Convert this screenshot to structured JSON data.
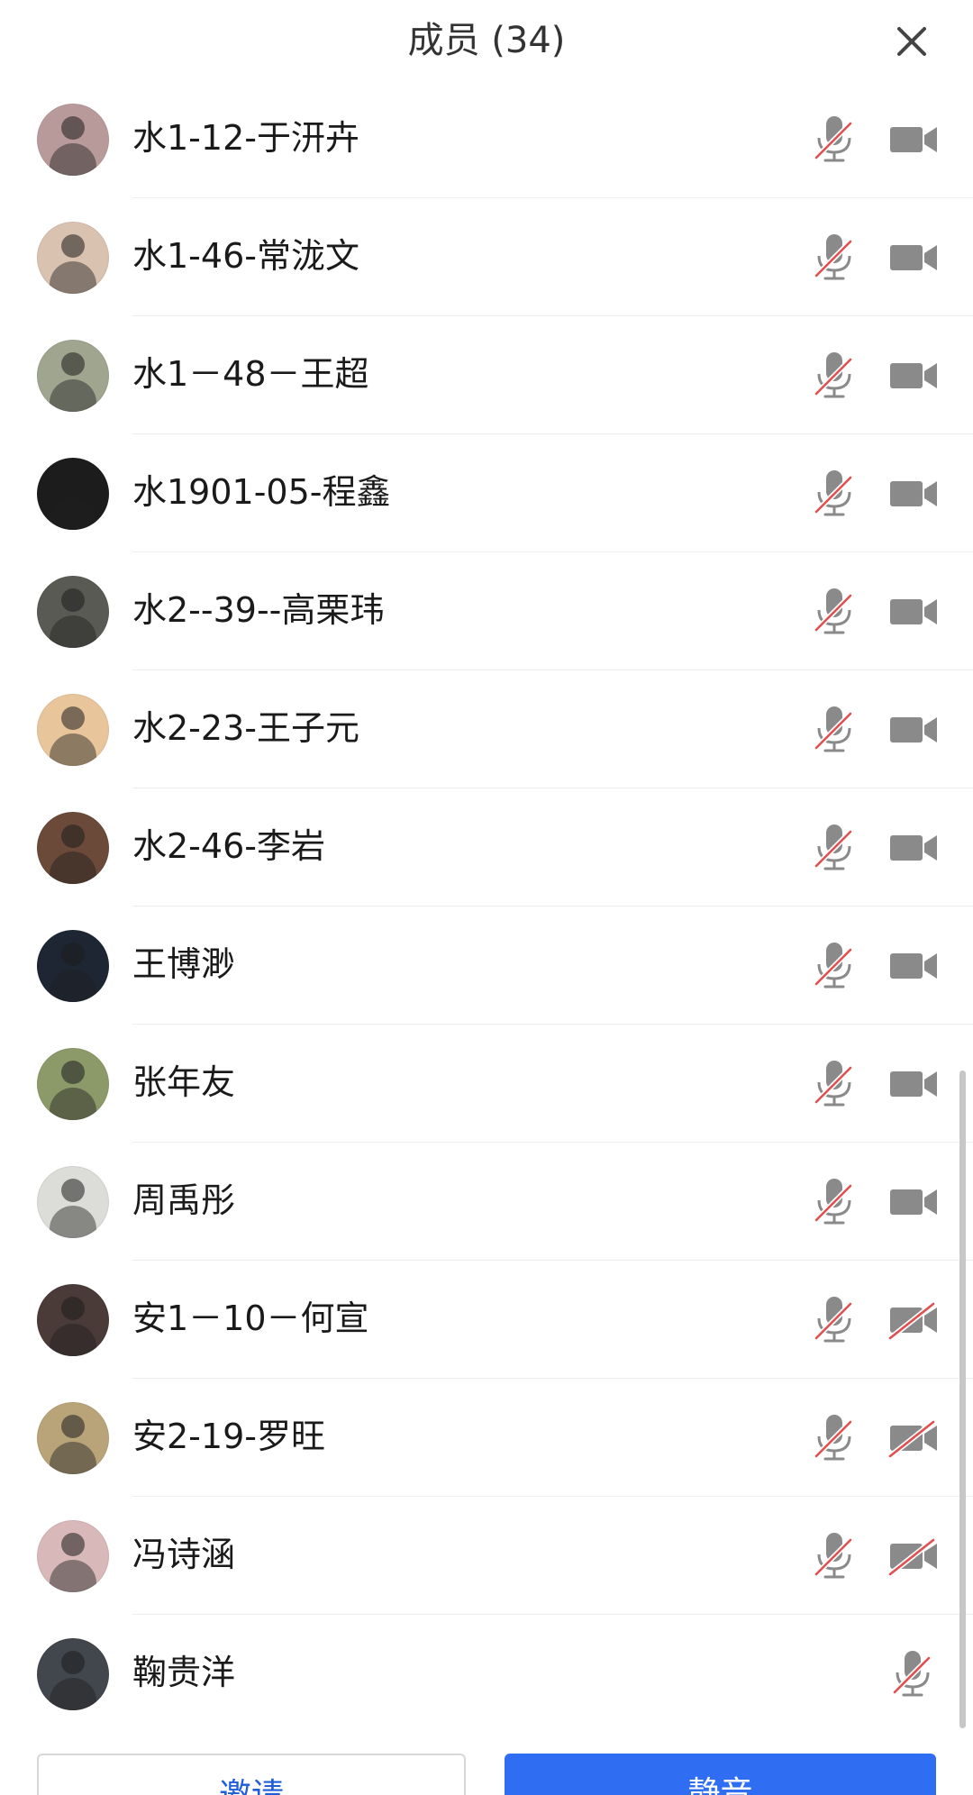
{
  "header": {
    "title": "成员 (34)"
  },
  "icons": {
    "close": "close-icon",
    "mic_muted": "microphone-muted-icon",
    "camera": "video-camera-icon",
    "camera_off": "video-camera-off-icon"
  },
  "colors": {
    "icon_gray": "#8a8a8a",
    "muted_red": "#e05050",
    "primary_blue": "#2f6ef3"
  },
  "members": [
    {
      "name": "水1-12-于汧卉",
      "mic": "muted",
      "camera": "on"
    },
    {
      "name": "水1-46-常泷文",
      "mic": "muted",
      "camera": "on"
    },
    {
      "name": "水1－48－王超",
      "mic": "muted",
      "camera": "on"
    },
    {
      "name": "水1901-05-程鑫",
      "mic": "muted",
      "camera": "on"
    },
    {
      "name": "水2--39--高栗玮",
      "mic": "muted",
      "camera": "on"
    },
    {
      "name": "水2-23-王子元",
      "mic": "muted",
      "camera": "on"
    },
    {
      "name": "水2-46-李岩",
      "mic": "muted",
      "camera": "on"
    },
    {
      "name": "王博渺",
      "mic": "muted",
      "camera": "on"
    },
    {
      "name": "张年友",
      "mic": "muted",
      "camera": "on"
    },
    {
      "name": "周禹彤",
      "mic": "muted",
      "camera": "on"
    },
    {
      "name": "安1－10－何宣",
      "mic": "muted",
      "camera": "off"
    },
    {
      "name": "安2-19-罗旺",
      "mic": "muted",
      "camera": "off"
    },
    {
      "name": "冯诗涵",
      "mic": "muted",
      "camera": "off"
    },
    {
      "name": "鞠贵洋",
      "mic": "muted",
      "camera": "none"
    }
  ],
  "avatar_colors": [
    "#b89a9a",
    "#d9c2b0",
    "#9fa58f",
    "#1c1c1c",
    "#5a5a55",
    "#e8c59b",
    "#6b4a3a",
    "#1e2633",
    "#8c9a6a",
    "#dcdcd8",
    "#4a3a38",
    "#b9a47a",
    "#d8b8b8",
    "#42464d"
  ],
  "footer": {
    "invite_label": "邀请",
    "mute_all_label": "静音"
  }
}
